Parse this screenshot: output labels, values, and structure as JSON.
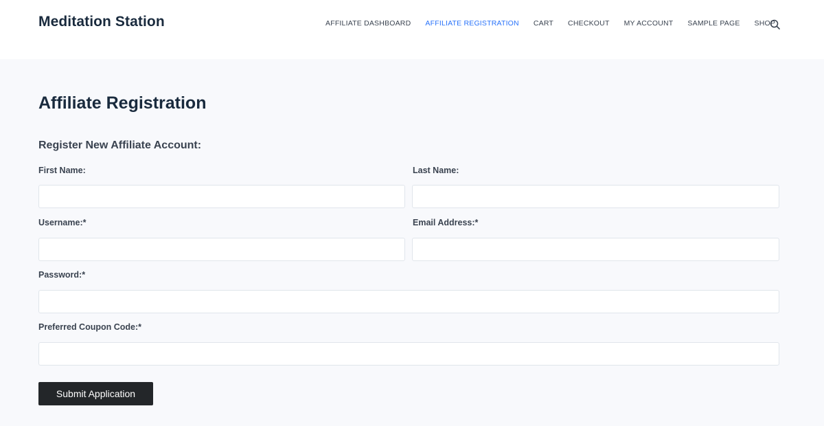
{
  "site": {
    "title": "Meditation Station"
  },
  "nav": {
    "items": [
      {
        "label": "AFFILIATE DASHBOARD"
      },
      {
        "label": "AFFILIATE REGISTRATION"
      },
      {
        "label": "CART"
      },
      {
        "label": "CHECKOUT"
      },
      {
        "label": "MY ACCOUNT"
      },
      {
        "label": "SAMPLE PAGE"
      },
      {
        "label": "SHOP"
      }
    ],
    "active_index": 1,
    "search_icon": "search-icon"
  },
  "page": {
    "title": "Affiliate Registration",
    "form_heading": "Register New Affiliate Account:"
  },
  "form": {
    "first_name": {
      "label": "First Name:",
      "value": ""
    },
    "last_name": {
      "label": "Last Name:",
      "value": ""
    },
    "username": {
      "label": "Username:*",
      "value": ""
    },
    "email": {
      "label": "Email Address:*",
      "value": ""
    },
    "password": {
      "label": "Password:*",
      "value": ""
    },
    "coupon": {
      "label": "Preferred Coupon Code:*",
      "value": ""
    },
    "submit_label": "Submit Application"
  },
  "colors": {
    "accent": "#2872fa",
    "heading": "#192a3d",
    "text": "#3a4350",
    "page_bg": "#f8f9fc",
    "button_bg": "#232629"
  }
}
